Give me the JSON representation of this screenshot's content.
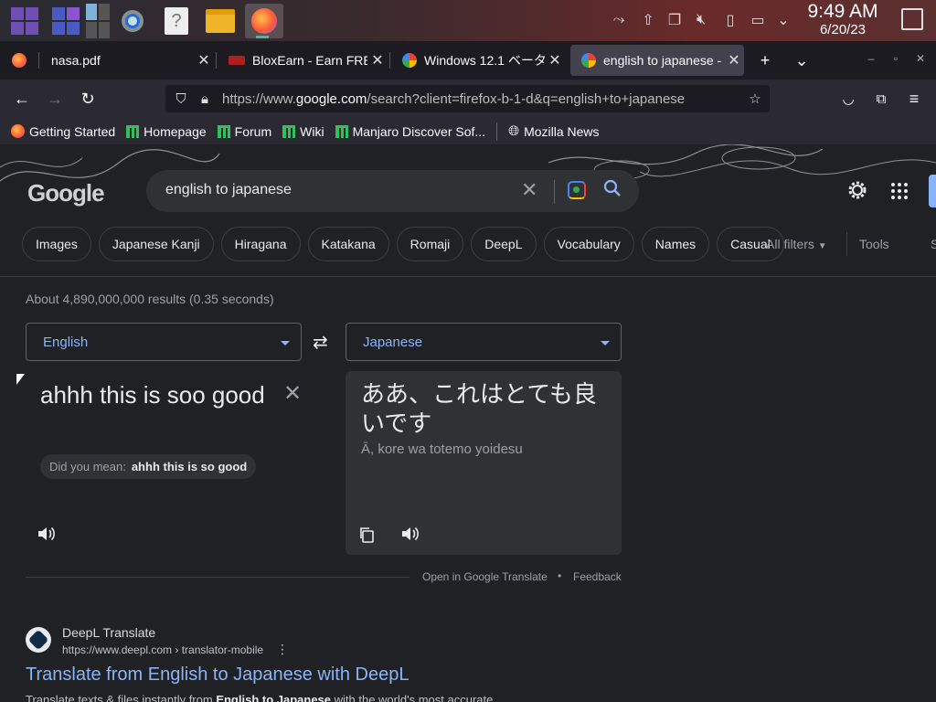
{
  "taskbar": {
    "apps": [
      {
        "name": "app-launcher"
      },
      {
        "name": "virtual-desktops"
      },
      {
        "name": "window-switcher"
      },
      {
        "name": "system-settings"
      },
      {
        "name": "help"
      },
      {
        "name": "file-manager"
      },
      {
        "name": "firefox",
        "active": true
      }
    ],
    "clock": {
      "time": "9:49 AM",
      "date": "6/20/23"
    }
  },
  "tabs": [
    {
      "label": "nasa.pdf",
      "icon": "firefox-icon",
      "active": false
    },
    {
      "label": "BloxEarn - Earn FREE",
      "icon": "bloxearn-icon",
      "active": false
    },
    {
      "label": "Windows 12.1 ベータ",
      "icon": "google-icon",
      "active": false
    },
    {
      "label": "english to japanese -",
      "icon": "google-icon",
      "active": true
    }
  ],
  "url": {
    "prefix": "https://www.",
    "domain": "google.com",
    "rest": "/search?client=firefox-b-1-d&q=english+to+japanese"
  },
  "bookmarks": [
    {
      "label": "Getting Started",
      "icon": "firefox-icon"
    },
    {
      "label": "Homepage",
      "icon": "manjaro-icon"
    },
    {
      "label": "Forum",
      "icon": "manjaro-icon"
    },
    {
      "label": "Wiki",
      "icon": "manjaro-icon"
    },
    {
      "label": "Manjaro Discover Sof...",
      "icon": "manjaro-icon"
    },
    {
      "label": "Mozilla News",
      "icon": "globe-icon"
    }
  ],
  "google": {
    "logo": "Google",
    "query": "english to japanese",
    "chips": [
      "Images",
      "Japanese Kanji",
      "Hiragana",
      "Katakana",
      "Romaji",
      "DeepL",
      "Vocabulary",
      "Names",
      "Casual"
    ],
    "all_filters": "All filters",
    "tools": "Tools",
    "edge_letter": "S",
    "stats": "About 4,890,000,000 results (0.35 seconds)"
  },
  "translate": {
    "source_lang": "English",
    "target_lang": "Japanese",
    "source_text": "ahhh this is soo good",
    "did_you_mean_label": "Did you mean:",
    "did_you_mean_value": "ahhh this is so good",
    "target_text": "ああ、これはとても良いです",
    "romanization": "Ā, kore wa totemo yoidesu",
    "open_link": "Open in Google Translate",
    "separator": "•",
    "feedback": "Feedback"
  },
  "result": {
    "site": "DeepL Translate",
    "url": "https://www.deepl.com › translator-mobile",
    "title": "Translate from English to Japanese with DeepL",
    "snippet_pre": "Translate texts & files instantly from ",
    "snippet_bold": "English to Japanese",
    "snippet_post": " with the world's most accurate ..."
  },
  "colors": {
    "accent": "#8ab4f8",
    "page_bg": "#202124",
    "firefox_toolbar": "#2b2a33"
  }
}
